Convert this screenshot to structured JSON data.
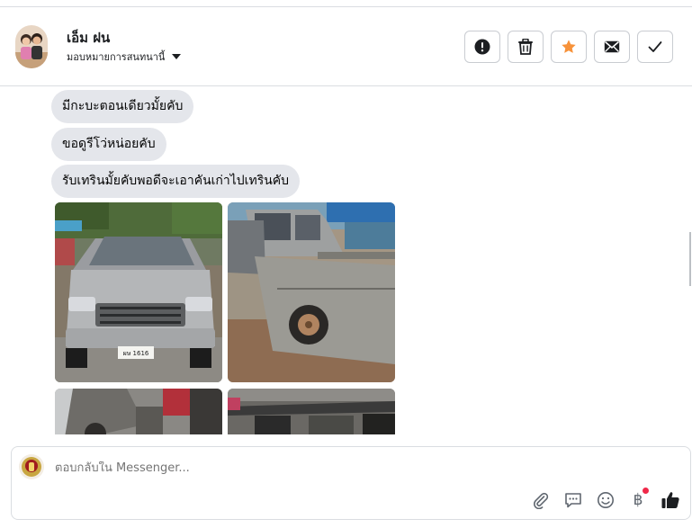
{
  "header": {
    "name": "เอ็ม ฝน",
    "assignment_label": "มอบหมายการสนทนานี้"
  },
  "toolbar": {
    "buttons": [
      {
        "name": "mark-spam",
        "icon": "exclamation-circle-icon"
      },
      {
        "name": "delete",
        "icon": "trash-icon"
      },
      {
        "name": "star",
        "icon": "star-icon",
        "color": "#f7923a"
      },
      {
        "name": "mark-unread",
        "icon": "envelope-icon"
      },
      {
        "name": "mark-done",
        "icon": "check-icon"
      }
    ]
  },
  "messages": [
    {
      "text": "มีกะบะตอนเดียวมั้ยคับ"
    },
    {
      "text": "ขอดูรีโว่หน่อยคับ"
    },
    {
      "text": "รับเทรินมั้ยคับพอดีจะเอาคันเก่าไปเทรินคับ"
    }
  ],
  "photos": [
    {
      "plate": "ผษ 1616"
    },
    {
      "plate": ""
    },
    {
      "plate": ""
    },
    {
      "plate": ""
    }
  ],
  "composer": {
    "placeholder": "ตอบกลับใน Messenger...",
    "currency_symbol": "฿"
  },
  "colors": {
    "bubble": "#e4e6eb",
    "border": "#dadde1",
    "accent_star": "#f7923a",
    "notification_dot": "#f02849"
  }
}
